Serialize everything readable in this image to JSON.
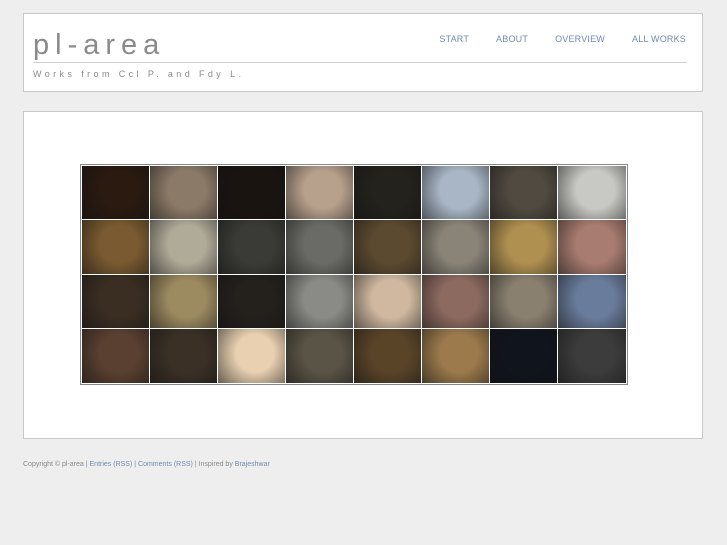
{
  "header": {
    "title": "pl-area",
    "tagline": "Works from Ccl P. and Fdy L."
  },
  "nav": {
    "items": [
      {
        "label": "START"
      },
      {
        "label": "ABOUT"
      },
      {
        "label": "OVERVIEW"
      },
      {
        "label": "ALL WORKS"
      }
    ]
  },
  "gallery": {
    "rows": 4,
    "cols": 8,
    "thumbs": [
      [
        "#2a1a10",
        "#8c7a68",
        "#1a1410",
        "#b7a08c",
        "#24221c",
        "#a8b6c6",
        "#504a40",
        "#c8c8c4"
      ],
      [
        "#7a5a30",
        "#b0aa98",
        "#3a3a36",
        "#6a6a66",
        "#5c4a30",
        "#8a8478",
        "#b09050",
        "#a87c70"
      ],
      [
        "#3a2e22",
        "#9c8a60",
        "#24201c",
        "#8a8a86",
        "#d0b8a0",
        "#8c6a60",
        "#8a8070",
        "#6a7c9c"
      ],
      [
        "#5a4030",
        "#3a3026",
        "#e8d0b0",
        "#5a5446",
        "#5a4428",
        "#9c7a4c",
        "#10141c",
        "#3c3c3c"
      ]
    ]
  },
  "footer": {
    "copyright": "Copyright © pl-area | ",
    "entries_link": "Entries (RSS)",
    "sep1": " | ",
    "comments_link": "Comments (RSS)",
    "sep2": " | Inspired by ",
    "inspired_link": "Brajeshwar"
  },
  "colors": {
    "background": "#eeeeee",
    "link": "#6f8bb3",
    "text": "#8a8a8a"
  }
}
